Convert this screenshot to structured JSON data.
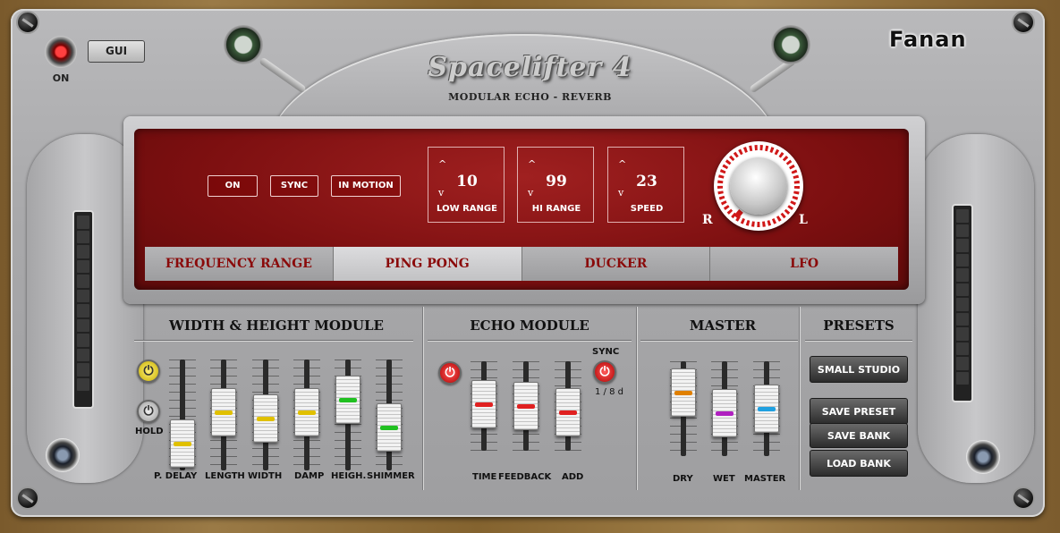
{
  "app": {
    "title": "Spacelifter 4",
    "subtitle": "MODULAR ECHO - REVERB",
    "brand": "Fanan"
  },
  "power": {
    "label": "ON",
    "gui_label": "GUI"
  },
  "display": {
    "buttons": [
      "ON",
      "SYNC",
      "IN MOTION"
    ],
    "values": [
      {
        "value": "10",
        "label": "LOW RANGE"
      },
      {
        "value": "99",
        "label": "HI RANGE"
      },
      {
        "value": "23",
        "label": "SPEED"
      }
    ],
    "arrow_up": "^",
    "arrow_down": "v",
    "knob_left_label": "R",
    "knob_right_label": "L",
    "tabs": [
      "FREQUENCY RANGE",
      "PING PONG",
      "DUCKER",
      "LFO"
    ],
    "active_tab": "PING PONG"
  },
  "sections": {
    "width_height": "WIDTH & HEIGHT MODULE",
    "echo": "ECHO MODULE",
    "master": "MASTER",
    "presets": "PRESETS"
  },
  "width_height": {
    "hold_label": "HOLD",
    "faders": [
      {
        "label": "P. DELAY",
        "color": "#e0c000",
        "level": 0.05
      },
      {
        "label": "LENGTH",
        "color": "#e0c000",
        "level": 0.55
      },
      {
        "label": "WIDTH",
        "color": "#e0c000",
        "level": 0.45
      },
      {
        "label": "DAMP",
        "color": "#e0c000",
        "level": 0.55
      },
      {
        "label": "HEIGH.",
        "color": "#20c020",
        "level": 0.75
      },
      {
        "label": "SHIMMER",
        "color": "#20c020",
        "level": 0.3
      }
    ]
  },
  "echo": {
    "sync_label": "SYNC",
    "sync_value": "1 / 8 d",
    "faders": [
      {
        "label": "TIME",
        "color": "#e02020",
        "level": 0.55
      },
      {
        "label": "FEEDBACK",
        "color": "#e02020",
        "level": 0.5
      },
      {
        "label": "ADD",
        "color": "#e02020",
        "level": 0.35
      }
    ]
  },
  "master": {
    "faders": [
      {
        "label": "DRY",
        "color": "#e08000",
        "level": 0.85
      },
      {
        "label": "WET",
        "color": "#b020c0",
        "level": 0.4
      },
      {
        "label": "MASTER",
        "color": "#20a0e0",
        "level": 0.5
      }
    ]
  },
  "presets": {
    "current": "SMALL STUDIO",
    "save_preset": "SAVE PRESET",
    "save_bank": "SAVE BANK",
    "load_bank": "LOAD BANK"
  },
  "colors": {
    "display_red": "#7c0f10",
    "tab_text": "#8a0a0a"
  }
}
